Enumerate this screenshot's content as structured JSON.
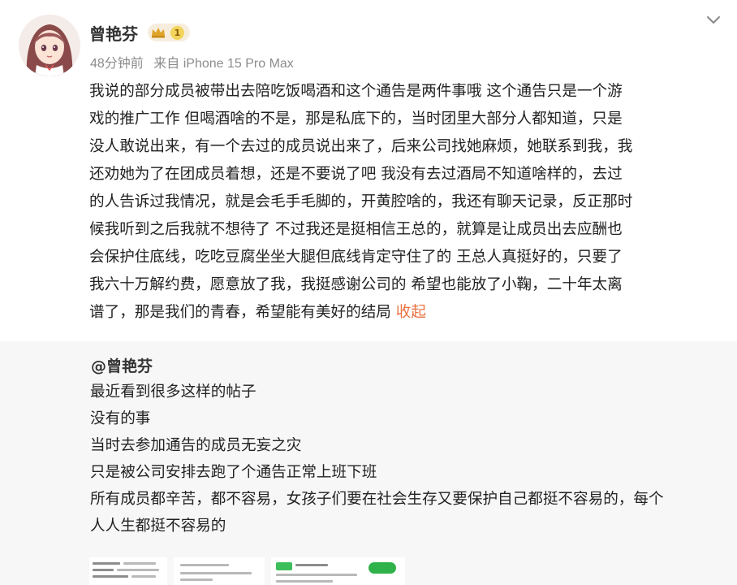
{
  "post": {
    "username": "曾艳芬",
    "level": "1",
    "time": "48分钟前",
    "source": "来自 iPhone 15 Pro Max",
    "avatar_icon": "anime-girl-avatar",
    "menu_icon": "chevron-down-icon",
    "content_lines": [
      "我说的部分成员被带出去陪吃饭喝酒和这个通告是两件事哦 这个通告只是一个游",
      "戏的推广工作 但喝酒啥的不是，那是私底下的，当时团里大部分人都知道，只是",
      "没人敢说出来，有一个去过的成员说出来了，后来公司找她麻烦，她联系到我，我",
      "还劝她为了在团成员着想，还是不要说了吧 我没有去过酒局不知道啥样的，去过",
      "的人告诉过我情况，就是会毛手毛脚的，开黄腔啥的，我还有聊天记录，反正那时",
      "候我听到之后我就不想待了 不过我还是挺相信王总的，就算是让成员出去应酬也",
      "会保护住底线，吃吃豆腐坐坐大腿但底线肯定守住了的 王总人真挺好的，只要了",
      "我六十万解约费，愿意放了我，我挺感谢公司的 希望也能放了小鞠，二十年太离",
      "谱了，那是我们的青春，希望能有美好的结局 "
    ],
    "collapse_label": "收起",
    "accent_color": "#eb7340"
  },
  "quoted": {
    "author": "@曾艳芬",
    "lines": [
      "最近看到很多这样的帖子",
      "没有的事",
      "当时去参加通告的成员无妄之灾",
      "只是被公司安排去跑了个通告正常上班下班",
      "所有成员都辛苦，都不容易，女孩子们要在社会生存又要保护自己都挺不容易的，每个",
      "人人生都挺不容易的"
    ],
    "background": "#f7f7f7"
  }
}
